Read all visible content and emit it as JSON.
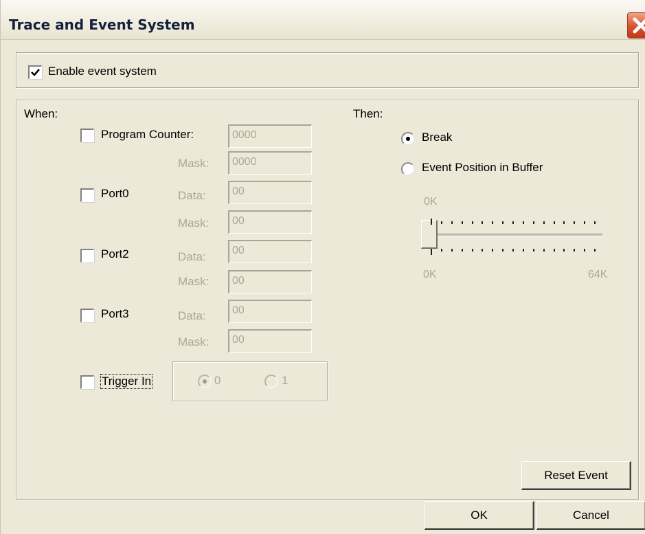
{
  "window": {
    "title": "Trace and Event System"
  },
  "enable_event_system": {
    "label": "Enable event system",
    "checked": true
  },
  "when": {
    "label": "When:",
    "program_counter": {
      "label": "Program Counter:",
      "value": "0000",
      "mask_label": "Mask:",
      "mask_value": "0000",
      "checked": false
    },
    "port0": {
      "label": "Port0",
      "data_label": "Data:",
      "data_value": "00",
      "mask_label": "Mask:",
      "mask_value": "00",
      "checked": false
    },
    "port2": {
      "label": "Port2",
      "data_label": "Data:",
      "data_value": "00",
      "mask_label": "Mask:",
      "mask_value": "00",
      "checked": false
    },
    "port3": {
      "label": "Port3",
      "data_label": "Data:",
      "data_value": "00",
      "mask_label": "Mask:",
      "mask_value": "00",
      "checked": false
    },
    "trigger_in": {
      "label": "Trigger In",
      "checked": false,
      "options": [
        "0",
        "1"
      ],
      "selected": "0"
    }
  },
  "then": {
    "label": "Then:",
    "break_label": "Break",
    "event_position_label": "Event Position in Buffer",
    "selected": "Break",
    "slider": {
      "current_label": "0K",
      "min_label": "0K",
      "max_label": "64K",
      "value": 0
    }
  },
  "buttons": {
    "reset_event": "Reset Event",
    "ok": "OK",
    "cancel": "Cancel"
  },
  "colors": {
    "dialog_bg": "#ece9d8",
    "close_button": "#d9502f",
    "title_text": "#14213d",
    "disabled_text": "#aca899"
  }
}
